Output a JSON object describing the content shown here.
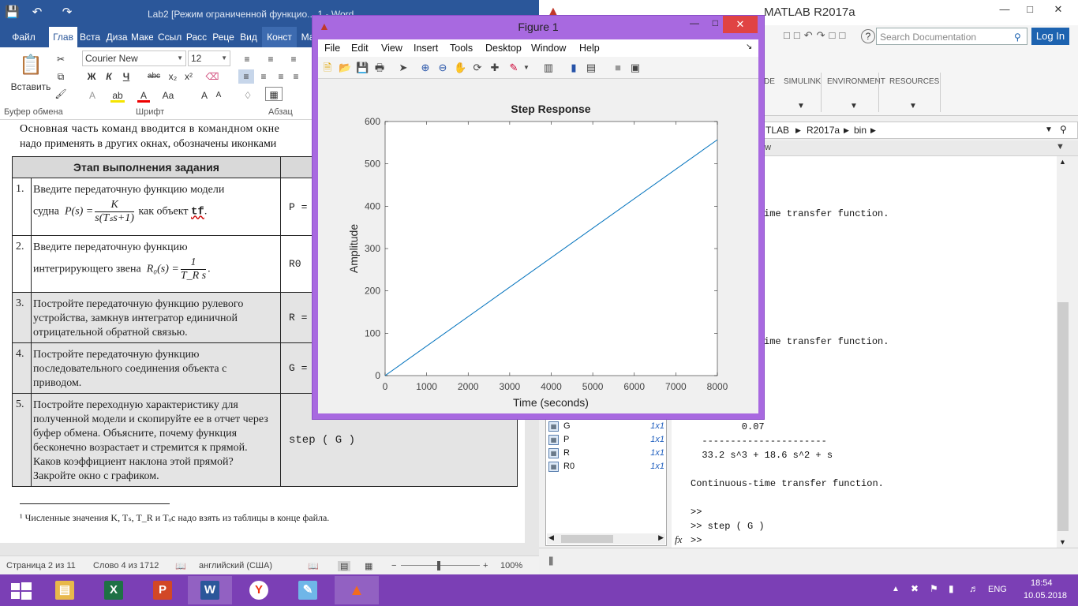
{
  "word": {
    "title": "Lab2 [Режим ограниченной функцио... 1 - Word",
    "tabs": [
      "Файл",
      "Глав",
      "Вста",
      "Диза",
      "Маке",
      "Ссыл",
      "Расс",
      "Реце",
      "Вид",
      "Конст",
      "Ма"
    ],
    "clipboard": {
      "paste_label": "Вставить",
      "group_label": "Буфер обмена"
    },
    "font": {
      "name": "Courier New",
      "size": "12",
      "group_label": "Шрифт",
      "bold": "Ж",
      "italic": "К",
      "underline": "Ч",
      "strike": "abc",
      "subscript": "x₂",
      "superscript": "x²"
    },
    "paragraph": {
      "group_label": "Абзац"
    },
    "doc": {
      "intro_line1": "Основная часть команд вводится в командном окне",
      "intro_line2": "надо применять в других окнах, обозначены иконками",
      "table_header": "Этап выполнения задания",
      "rows": [
        {
          "num": "1.",
          "text_a": "Введите передаточную функцию модели",
          "text_b": "судна",
          "formula_lhs": "P(s) =",
          "frac_num": "K",
          "frac_den": "s(Tₛs+1)",
          "text_c": "как объект",
          "code": "tf",
          "cmd": "P ="
        },
        {
          "num": "2.",
          "text_a": "Введите передаточную функцию",
          "text_b": "интегрирующего звена",
          "formula_lhs": "R₀(s) =",
          "frac_num": "1",
          "frac_den": "T_R s",
          "cmd": "R0"
        },
        {
          "num": "3.",
          "text": "Постройте передаточную функцию рулевого устройства, замкнув интегратор единичной отрицательной обратной связью.",
          "cmd": "R ="
        },
        {
          "num": "4.",
          "text": "Постройте передаточную функцию последовательного соединения объекта с приводом.",
          "cmd": "G ="
        },
        {
          "num": "5.",
          "text": "Постройте переходную характеристику для полученной модели и скопируйте ее в отчет через буфер обмена. Объясните, почему функция бесконечно возрастает и стремится к прямой. Каков коэффициент наклона этой прямой? Закройте окно с графиком.",
          "cmd": "step ( G )"
        }
      ],
      "footnote": "¹ Численные значения K, Tₛ, T_R и Tₒc надо взять из таблицы в конце файла."
    },
    "status": {
      "page": "Страница 2 из 11",
      "words": "Слово 4 из 1712",
      "lang": "английский (США)",
      "zoom": "100%"
    }
  },
  "matlab": {
    "title": "MATLAB R2017a",
    "search_placeholder": "Search Documentation",
    "login": "Log In",
    "sections": [
      "DE",
      "SIMULINK",
      "ENVIRONMENT",
      "RESOURCES"
    ],
    "path": [
      "TLAB",
      "R2017a",
      "bin"
    ],
    "cmd_header": "ow",
    "cmd_lines": [
      "ime transfer function.",
      "ime transfer function.",
      "         0.07",
      "  ----------------------",
      "  33.2 s^3 + 18.6 s^2 + s",
      "Continuous-time transfer function.",
      ">>",
      ">> step ( G )",
      ">>"
    ],
    "workspace": [
      {
        "name": "G",
        "value": "1x1"
      },
      {
        "name": "P",
        "value": "1x1"
      },
      {
        "name": "R",
        "value": "1x1"
      },
      {
        "name": "R0",
        "value": "1x1"
      }
    ]
  },
  "figure": {
    "title": "Figure 1",
    "menu": [
      "File",
      "Edit",
      "View",
      "Insert",
      "Tools",
      "Desktop",
      "Window",
      "Help"
    ],
    "line_color": "#0072bd"
  },
  "chart_data": {
    "type": "line",
    "title": "Step Response",
    "xlabel": "Time (seconds)",
    "ylabel": "Amplitude",
    "xlim": [
      0,
      8000
    ],
    "ylim": [
      0,
      600
    ],
    "xticks": [
      0,
      1000,
      2000,
      3000,
      4000,
      5000,
      6000,
      7000,
      8000
    ],
    "yticks": [
      0,
      100,
      200,
      300,
      400,
      500,
      600
    ],
    "series": [
      {
        "x": [
          0,
          8000
        ],
        "y": [
          0,
          557
        ]
      }
    ]
  },
  "taskbar": {
    "apps": [
      "Проводник",
      "Excel",
      "PowerPoint",
      "Word",
      "Яндекс",
      "Блокнот",
      "MATLAB"
    ],
    "lang": "ENG",
    "time": "18:54",
    "date": "10.05.2018"
  }
}
